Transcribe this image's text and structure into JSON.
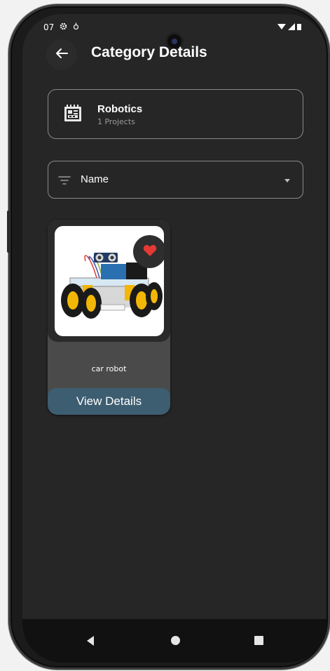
{
  "status_bar": {
    "time": "07",
    "icons_left": [
      "gear-icon",
      "notification-icon"
    ],
    "icons_right": [
      "wifi-icon",
      "signal-icon",
      "battery-icon"
    ]
  },
  "app_bar": {
    "title": "Category Details",
    "back_icon": "arrow-left-icon"
  },
  "category": {
    "name": "Robotics",
    "count_label": "1 Projects",
    "icon": "circuit-board-icon"
  },
  "sort": {
    "selected": "Name",
    "icon": "filter-lines-icon"
  },
  "projects": [
    {
      "name": "car robot",
      "favorited": true,
      "action_label": "View Details"
    }
  ],
  "nav_bar": {
    "buttons": [
      "back",
      "home",
      "recents"
    ]
  },
  "colors": {
    "background": "#262626",
    "card": "#4a4a4a",
    "accent_button": "#3d5d70",
    "favorite": "#e53935"
  }
}
